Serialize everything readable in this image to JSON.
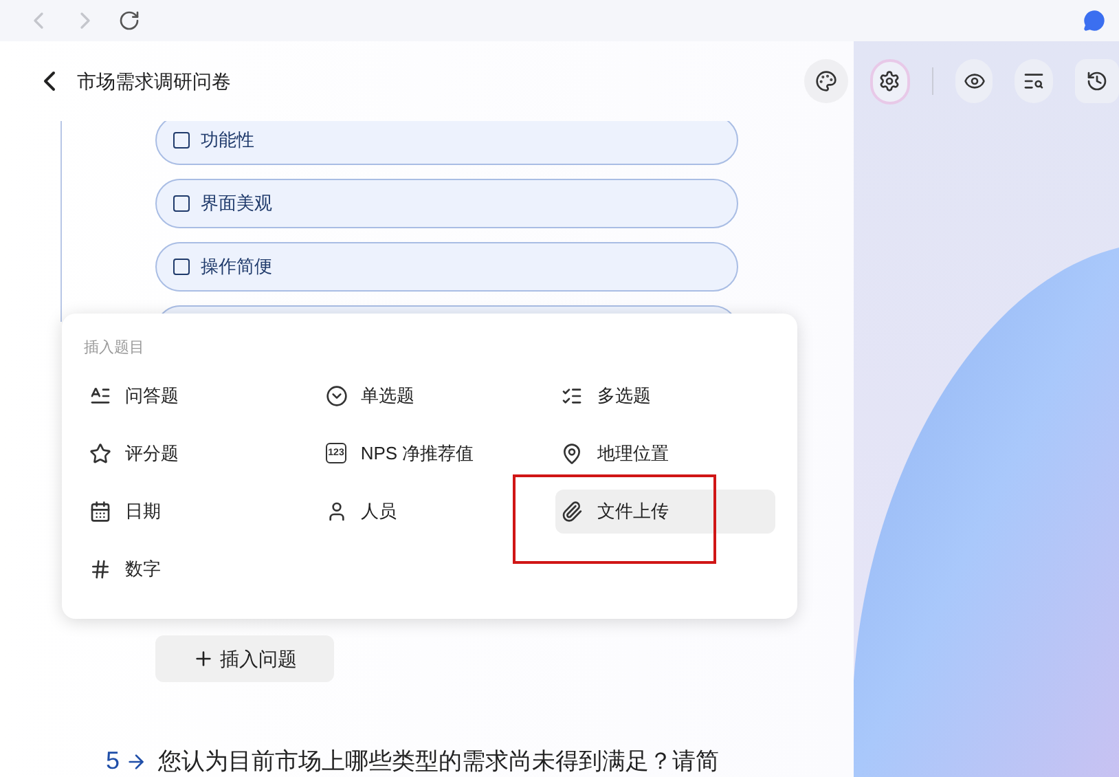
{
  "header": {
    "title": "市场需求调研问卷"
  },
  "question": {
    "options": [
      {
        "label": "功能性",
        "checked": false
      },
      {
        "label": "界面美观",
        "checked": false
      },
      {
        "label": "操作简便",
        "checked": false
      }
    ]
  },
  "insert_menu": {
    "title": "插入题目",
    "items": [
      {
        "kind": "text",
        "label": "问答题",
        "selected": false
      },
      {
        "kind": "single",
        "label": "单选题",
        "selected": false
      },
      {
        "kind": "multi",
        "label": "多选题",
        "selected": false
      },
      {
        "kind": "rating",
        "label": "评分题",
        "selected": false
      },
      {
        "kind": "nps",
        "label": "NPS 净推荐值",
        "icon_label": "123",
        "selected": false
      },
      {
        "kind": "location",
        "label": "地理位置",
        "selected": false
      },
      {
        "kind": "date",
        "label": "日期",
        "selected": false
      },
      {
        "kind": "person",
        "label": "人员",
        "selected": false
      },
      {
        "kind": "file",
        "label": "文件上传",
        "selected": true
      },
      {
        "kind": "number",
        "label": "数字",
        "selected": false
      }
    ]
  },
  "insert_button": {
    "label": "插入问题"
  },
  "next_question": {
    "number": "5",
    "text": "您认为目前市场上哪些类型的需求尚未得到满足？请简"
  }
}
